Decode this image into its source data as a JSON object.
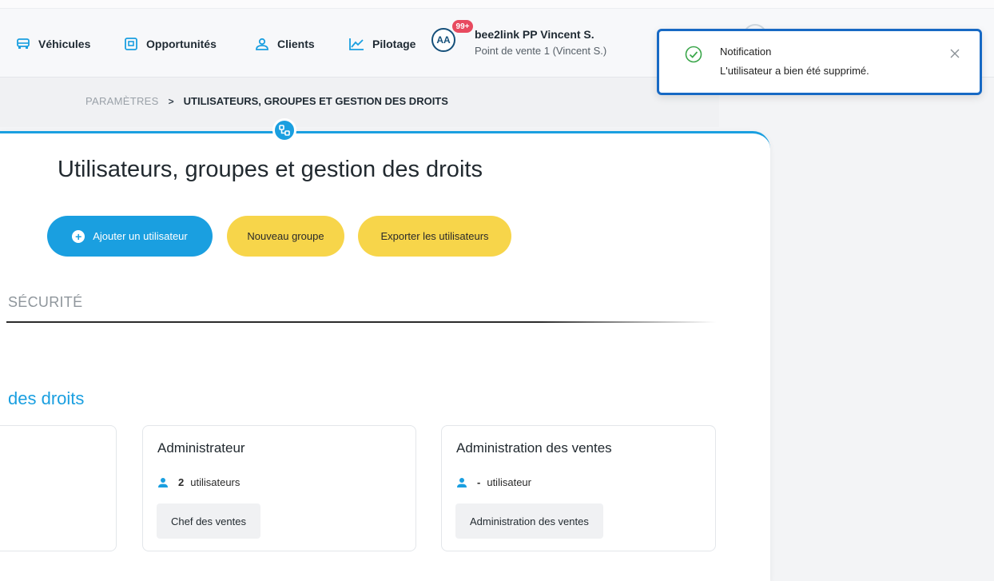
{
  "nav": {
    "items": [
      {
        "label": "Véhicules",
        "icon": "car-icon"
      },
      {
        "label": "Opportunités",
        "icon": "opportunity-icon"
      },
      {
        "label": "Clients",
        "icon": "user-icon"
      },
      {
        "label": "Pilotage",
        "icon": "chart-line-icon"
      }
    ],
    "avatar_initials": "AA",
    "notification_badge": "99+",
    "user_name": "bee2link PP Vincent S.",
    "user_point_of_sale": "Point de vente 1 (Vincent S.)"
  },
  "breadcrumb": {
    "root": "PARAMÈTRES",
    "separator": ">",
    "current": "UTILISATEURS, GROUPES ET GESTION DES DROITS"
  },
  "page": {
    "title": "Utilisateurs, groupes et gestion des droits",
    "buttons": {
      "add_user": "Ajouter un utilisateur",
      "new_group": "Nouveau groupe",
      "export_users": "Exporter les utilisateurs"
    },
    "section_tab": "SÉCURITÉ",
    "rights_title": "des droits"
  },
  "groups": [
    {
      "title": "Administrateur",
      "count": "2",
      "unit": "utilisateurs",
      "chip": "Chef des ventes"
    },
    {
      "title": "Administration des ventes",
      "count": "-",
      "unit": "utilisateur",
      "chip": "Administration des ventes"
    }
  ],
  "notification": {
    "title": "Notification",
    "message": "L'utilisateur a bien été supprimé."
  },
  "colors": {
    "primary": "#1a9fe0",
    "accent_yellow": "#f7d54a",
    "toast_border": "#1769c4",
    "success": "#3aa64a",
    "badge": "#e84a5f"
  }
}
